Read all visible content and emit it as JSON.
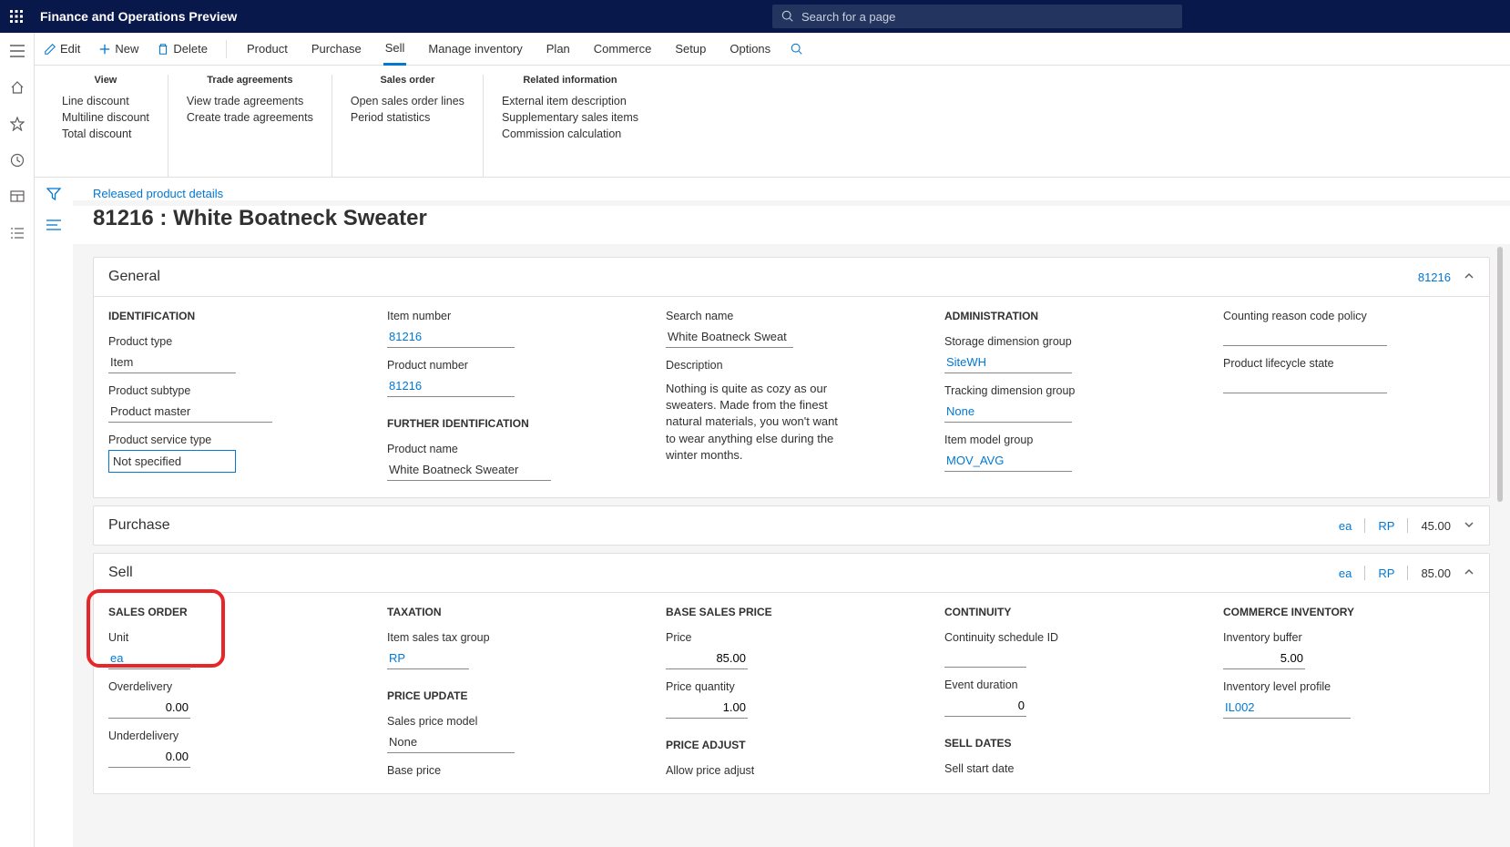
{
  "app": {
    "title": "Finance and Operations Preview",
    "search_placeholder": "Search for a page"
  },
  "actions": {
    "edit": "Edit",
    "new": "New",
    "delete": "Delete"
  },
  "tabs": [
    "Product",
    "Purchase",
    "Sell",
    "Manage inventory",
    "Plan",
    "Commerce",
    "Setup",
    "Options"
  ],
  "active_tab": "Sell",
  "ribbon": {
    "view": {
      "title": "View",
      "items": [
        "Line discount",
        "Multiline discount",
        "Total discount"
      ]
    },
    "trade": {
      "title": "Trade agreements",
      "items": [
        "View trade agreements",
        "Create trade agreements"
      ]
    },
    "salesorder": {
      "title": "Sales order",
      "items": [
        "Open sales order lines",
        "Period statistics"
      ]
    },
    "related": {
      "title": "Related information",
      "items": [
        "External item description",
        "Supplementary sales items",
        "Commission calculation"
      ]
    }
  },
  "breadcrumb": "Released product details",
  "page_title": "81216 : White Boatneck Sweater",
  "general": {
    "title": "General",
    "summary_id": "81216",
    "identification": {
      "h": "IDENTIFICATION",
      "product_type_l": "Product type",
      "product_type": "Item",
      "product_subtype_l": "Product subtype",
      "product_subtype": "Product master",
      "service_type_l": "Product service type",
      "service_type": "Not specified"
    },
    "col2": {
      "item_number_l": "Item number",
      "item_number": "81216",
      "product_number_l": "Product number",
      "product_number": "81216",
      "further_h": "FURTHER IDENTIFICATION",
      "product_name_l": "Product name",
      "product_name": "White Boatneck Sweater"
    },
    "col3": {
      "search_name_l": "Search name",
      "search_name": "White Boatneck Sweat",
      "description_l": "Description",
      "description": "Nothing is quite as cozy as our sweaters. Made from the finest natural materials, you won't want to wear anything else during the winter months."
    },
    "admin": {
      "h": "ADMINISTRATION",
      "storage_l": "Storage dimension group",
      "storage": "SiteWH",
      "tracking_l": "Tracking dimension group",
      "tracking": "None",
      "model_l": "Item model group",
      "model": "MOV_AVG"
    },
    "col5": {
      "counting_l": "Counting reason code policy",
      "lifecycle_l": "Product lifecycle state"
    }
  },
  "purchase": {
    "title": "Purchase",
    "unit": "ea",
    "group": "RP",
    "price": "45.00"
  },
  "sell": {
    "title": "Sell",
    "unit_s": "ea",
    "group_s": "RP",
    "price_s": "85.00",
    "salesorder": {
      "h": "SALES ORDER",
      "unit_l": "Unit",
      "unit": "ea",
      "over_l": "Overdelivery",
      "over": "0.00",
      "under_l": "Underdelivery",
      "under": "0.00"
    },
    "taxation": {
      "h": "TAXATION",
      "tax_l": "Item sales tax group",
      "tax": "RP",
      "update_h": "PRICE UPDATE",
      "model_l": "Sales price model",
      "model": "None",
      "base_l": "Base price"
    },
    "base": {
      "h": "BASE SALES PRICE",
      "price_l": "Price",
      "price": "85.00",
      "qty_l": "Price quantity",
      "qty": "1.00",
      "adjust_h": "PRICE ADJUST",
      "adjust_l": "Allow price adjust"
    },
    "continuity": {
      "h": "CONTINUITY",
      "sched_l": "Continuity schedule ID",
      "dur_l": "Event duration",
      "dur": "0",
      "dates_h": "SELL DATES",
      "start_l": "Sell start date"
    },
    "commerce": {
      "h": "COMMERCE INVENTORY",
      "buf_l": "Inventory buffer",
      "buf": "5.00",
      "lvl_l": "Inventory level profile",
      "lvl": "IL002"
    }
  }
}
